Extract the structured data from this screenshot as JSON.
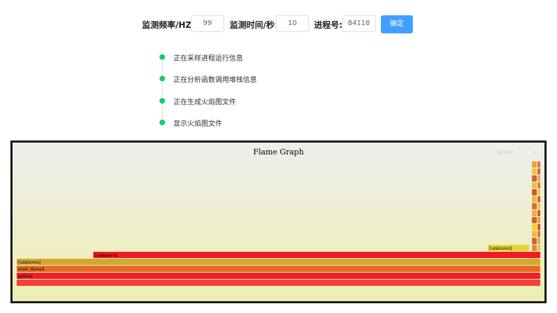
{
  "form": {
    "freq_label": "监测频率/HZ:",
    "freq_value": "99",
    "duration_label": "监测时间/秒:",
    "duration_value": "10",
    "pid_label": "进程号:",
    "pid_value": "84118",
    "confirm_label": "确定"
  },
  "steps": [
    {
      "label": "正在采样进程运行信息"
    },
    {
      "label": "正在分析函数调用堆栈信息"
    },
    {
      "label": "正在生成火焰图文件"
    },
    {
      "label": "显示火焰图文件"
    }
  ],
  "flamegraph": {
    "title": "Flame Graph",
    "search_label": "Search",
    "ic_label": "ic",
    "frames": [
      {
        "name": "",
        "color": "#f4413a"
      },
      {
        "name": "python",
        "color": "#f01f27"
      },
      {
        "name": "start_thread",
        "color": "#e46b27"
      },
      {
        "name": "[unknown]",
        "color": "#d4a830"
      },
      {
        "name": "[unknown]",
        "color": "#f21a24"
      },
      {
        "name": "[unknown]",
        "color": "#e5d531"
      }
    ]
  }
}
